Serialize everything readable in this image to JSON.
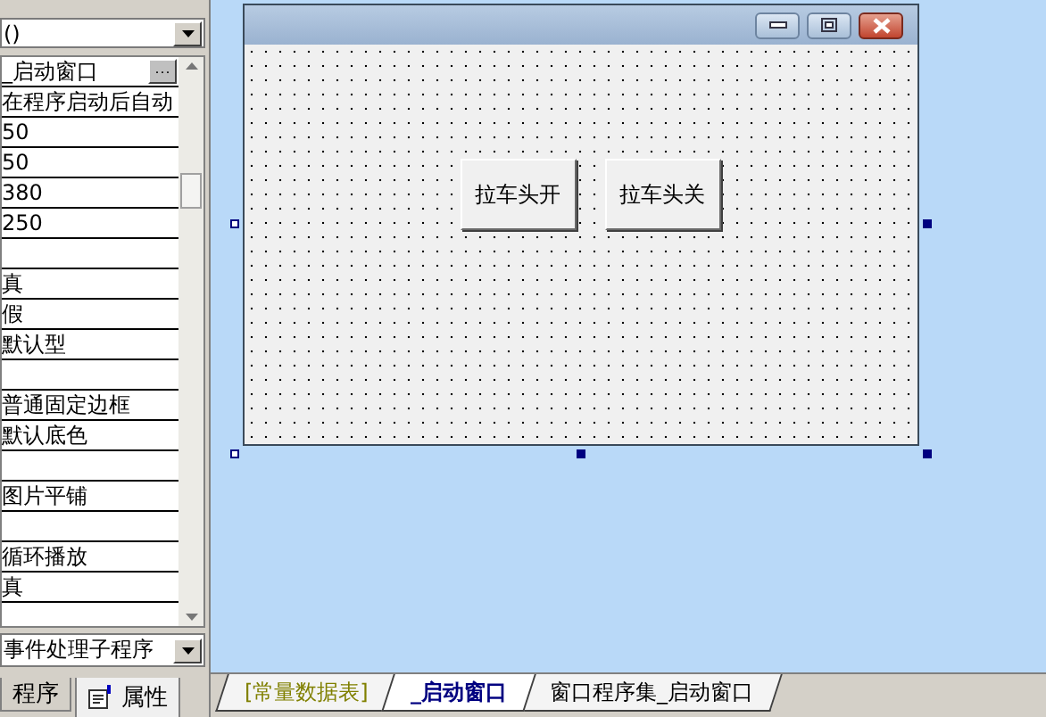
{
  "properties_panel": {
    "object_combo": "()",
    "rows": [
      {
        "value": "_启动窗口",
        "kind": "ellipsis",
        "button": "···"
      },
      {
        "value": "在程序启动后自动",
        "kind": "text"
      },
      {
        "value": "50",
        "kind": "text"
      },
      {
        "value": "50",
        "kind": "text"
      },
      {
        "value": "380",
        "kind": "text"
      },
      {
        "value": "250",
        "kind": "text"
      },
      {
        "value": "",
        "kind": "text"
      },
      {
        "value": "真",
        "kind": "text"
      },
      {
        "value": "假",
        "kind": "text"
      },
      {
        "value": "默认型",
        "kind": "text"
      },
      {
        "value": "",
        "kind": "text"
      },
      {
        "value": "普通固定边框",
        "kind": "text"
      },
      {
        "value": "默认底色",
        "kind": "text"
      },
      {
        "value": "",
        "kind": "text"
      },
      {
        "value": "图片平铺",
        "kind": "text"
      },
      {
        "value": "",
        "kind": "text"
      },
      {
        "value": "循环播放",
        "kind": "text"
      },
      {
        "value": "真",
        "kind": "text"
      }
    ],
    "event_combo": "事件处理子程序",
    "tabs": [
      {
        "label": "程序",
        "selected": false
      },
      {
        "label": "属性",
        "selected": true
      }
    ]
  },
  "designer": {
    "form_buttons": [
      {
        "label": "拉车头开"
      },
      {
        "label": "拉车头关"
      }
    ]
  },
  "editor_tabs": [
    {
      "label": "[常量数据表]",
      "kind": "constants",
      "selected": false
    },
    {
      "label": "_启动窗口",
      "kind": "window",
      "selected": true
    },
    {
      "label": "窗口程序集_启动窗口",
      "kind": "code",
      "selected": false
    }
  ]
}
